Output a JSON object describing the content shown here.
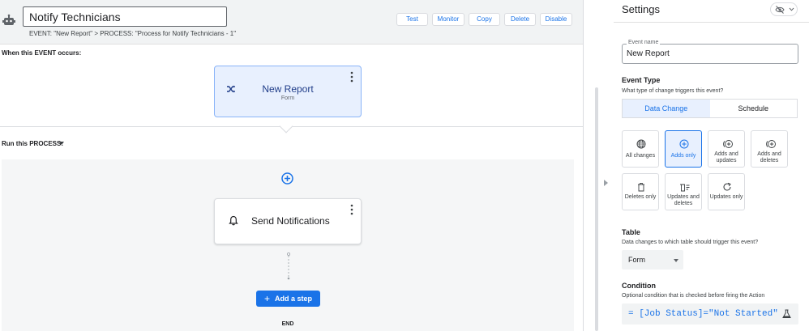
{
  "header": {
    "name_value": "Notify Technicians",
    "breadcrumb": "EVENT: \"New Report\" > PROCESS: \"Process for Notify Technicians - 1\"",
    "buttons": {
      "test": "Test",
      "monitor": "Monitor",
      "copy": "Copy",
      "delete": "Delete",
      "disable": "Disable"
    }
  },
  "event_section": {
    "label": "When this EVENT occurs:",
    "card_title": "New Report",
    "card_subtitle": "Form",
    "icon": "shuffle-icon"
  },
  "process_section": {
    "label": "Run this PROCESS:",
    "step_title": "Send Notifications",
    "step_icon": "bell-icon",
    "add_step_label": "Add a step",
    "end_label": "END"
  },
  "settings": {
    "title": "Settings",
    "event_name_label": "Event name",
    "event_name_value": "New Report",
    "event_type_title": "Event Type",
    "event_type_desc": "What type of change triggers this event?",
    "tabs": [
      {
        "label": "Data Change",
        "active": true
      },
      {
        "label": "Schedule",
        "active": false
      }
    ],
    "change_options": [
      {
        "label": "All changes",
        "icon": "globe-icon",
        "active": false
      },
      {
        "label": "Adds only",
        "icon": "add-circle-icon",
        "active": true
      },
      {
        "label": "Adds and updates",
        "icon": "add-update-icon",
        "active": false
      },
      {
        "label": "Adds and deletes",
        "icon": "add-delete-icon",
        "active": false
      },
      {
        "label": "Deletes only",
        "icon": "trash-icon",
        "active": false
      },
      {
        "label": "Updates and deletes",
        "icon": "update-delete-icon",
        "active": false
      },
      {
        "label": "Updates only",
        "icon": "refresh-icon",
        "active": false
      }
    ],
    "table_title": "Table",
    "table_desc": "Data changes to which table should trigger this event?",
    "table_value": "Form",
    "condition_title": "Condition",
    "condition_desc": "Optional condition that is checked before firing the Action",
    "condition_expr": "= [Job Status]=\"Not Started\""
  },
  "colors": {
    "accent": "#1a73e8",
    "selected_bg": "#e8f0fe"
  }
}
